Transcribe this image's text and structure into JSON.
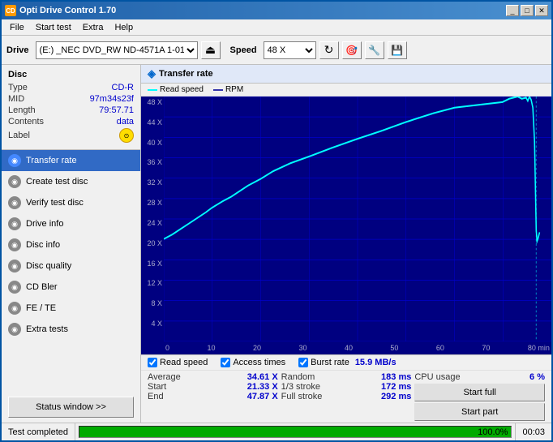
{
  "window": {
    "title": "Opti Drive Control 1.70",
    "icon": "CD"
  },
  "title_buttons": {
    "minimize": "_",
    "maximize": "□",
    "close": "✕"
  },
  "menu": {
    "items": [
      "File",
      "Start test",
      "Extra",
      "Help"
    ]
  },
  "toolbar": {
    "drive_label": "Drive",
    "drive_value": "(E:)  _NEC DVD_RW ND-4571A 1-01",
    "speed_label": "Speed",
    "speed_value": "48 X"
  },
  "disc": {
    "title": "Disc",
    "type_label": "Type",
    "type_value": "CD-R",
    "mid_label": "MID",
    "mid_value": "97m34s23f",
    "length_label": "Length",
    "length_value": "79:57.71",
    "contents_label": "Contents",
    "contents_value": "data",
    "label_label": "Label",
    "label_icon": "⊙"
  },
  "nav": {
    "items": [
      {
        "id": "transfer-rate",
        "label": "Transfer rate",
        "active": true,
        "icon": "◉"
      },
      {
        "id": "create-test-disc",
        "label": "Create test disc",
        "active": false,
        "icon": "◉"
      },
      {
        "id": "verify-test-disc",
        "label": "Verify test disc",
        "active": false,
        "icon": "◉"
      },
      {
        "id": "drive-info",
        "label": "Drive info",
        "active": false,
        "icon": "◉"
      },
      {
        "id": "disc-info",
        "label": "Disc info",
        "active": false,
        "icon": "◉"
      },
      {
        "id": "disc-quality",
        "label": "Disc quality",
        "active": false,
        "icon": "◉"
      },
      {
        "id": "cd-bler",
        "label": "CD Bler",
        "active": false,
        "icon": "◉"
      },
      {
        "id": "fe-te",
        "label": "FE / TE",
        "active": false,
        "icon": "◉"
      },
      {
        "id": "extra-tests",
        "label": "Extra tests",
        "active": false,
        "icon": "◉"
      }
    ]
  },
  "status_btn": "Status window >>",
  "panel": {
    "title": "Transfer rate"
  },
  "legend": {
    "read_speed_label": "Read speed",
    "read_speed_color": "#00ffff",
    "rpm_label": "RPM",
    "rpm_color": "#3333aa"
  },
  "chart": {
    "y_labels": [
      "48 X",
      "44 X",
      "40 X",
      "36 X",
      "32 X",
      "28 X",
      "24 X",
      "20 X",
      "16 X",
      "12 X",
      "8 X",
      "4 X",
      ""
    ],
    "x_labels": [
      "0",
      "10",
      "20",
      "30",
      "40",
      "50",
      "60",
      "70",
      "80 min"
    ]
  },
  "stats": {
    "checkboxes": {
      "read_speed": {
        "label": "Read speed",
        "checked": true
      },
      "access_times": {
        "label": "Access times",
        "checked": true
      },
      "burst_rate": {
        "label": "Burst rate",
        "checked": true
      }
    },
    "burst_value": "15.9 MB/s",
    "average_label": "Average",
    "average_value": "34.61 X",
    "random_label": "Random",
    "random_value": "183 ms",
    "cpu_usage_label": "CPU usage",
    "cpu_usage_value": "6 %",
    "start_label": "Start",
    "start_value": "21.33 X",
    "one_third_label": "1/3 stroke",
    "one_third_value": "172 ms",
    "start_full_btn": "Start full",
    "end_label": "End",
    "end_value": "47.87 X",
    "full_stroke_label": "Full stroke",
    "full_stroke_value": "292 ms",
    "start_part_btn": "Start part"
  },
  "status_bar": {
    "text": "Test completed",
    "progress": "100.0%",
    "time": "00:03"
  }
}
